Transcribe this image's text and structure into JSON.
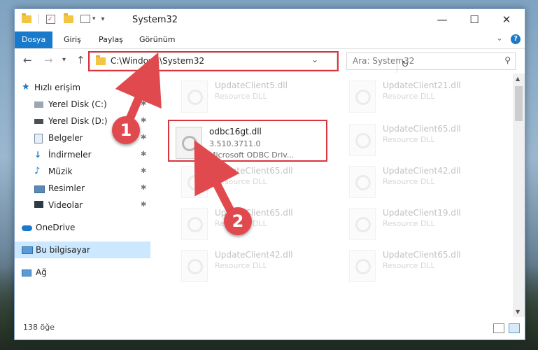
{
  "window": {
    "title": "System32",
    "dropdown_glyph": "▾",
    "controls": {
      "minimize": "—",
      "maximize": "☐",
      "close": "✕"
    }
  },
  "ribbon": {
    "tabs": [
      {
        "label": "Dosya",
        "active": true
      },
      {
        "label": "Giriş",
        "active": false
      },
      {
        "label": "Paylaş",
        "active": false
      },
      {
        "label": "Görünüm",
        "active": false
      }
    ],
    "collapse_glyph": "⌄",
    "help_glyph": "?"
  },
  "nav": {
    "back": "←",
    "forward": "→",
    "recent": "▾",
    "up": "↑",
    "address": "C:\\Windows\\System32",
    "address_dropdown": "⌄",
    "refresh": "↻",
    "search_placeholder": "Ara: System32",
    "search_icon": "⚲"
  },
  "sidebar": {
    "items": [
      {
        "label": "Hızlı erişim",
        "icon": "star-icon",
        "pinned": false
      },
      {
        "label": "Yerel Disk (C:)",
        "icon": "drive-icon",
        "pinned": true
      },
      {
        "label": "Yerel Disk (D:)",
        "icon": "drive-icon",
        "pinned": true
      },
      {
        "label": "Belgeler",
        "icon": "documents-icon",
        "pinned": true
      },
      {
        "label": "İndirmeler",
        "icon": "download-icon",
        "pinned": true
      },
      {
        "label": "Müzik",
        "icon": "music-icon",
        "pinned": true
      },
      {
        "label": "Resimler",
        "icon": "pictures-icon",
        "pinned": true
      },
      {
        "label": "Videolar",
        "icon": "videos-icon",
        "pinned": true
      },
      {
        "label": "OneDrive",
        "icon": "cloud-icon",
        "pinned": false
      },
      {
        "label": "Bu bilgisayar",
        "icon": "computer-icon",
        "pinned": false
      },
      {
        "label": "Ağ",
        "icon": "network-icon",
        "pinned": false
      }
    ],
    "pin_glyph": "📌"
  },
  "files": {
    "highlighted": {
      "name": "odbc16gt.dll",
      "version": "3.510.3711.0",
      "description": "Microsoft ODBC Driv..."
    },
    "left_column": [
      {
        "name": "UpdateClient5.dll",
        "type": "Resource DLL"
      },
      {
        "name": "UpdateClient65.dll",
        "type": "Resource DLL"
      },
      {
        "name": "UpdateClient65.dll",
        "type": "Resource DLL"
      },
      {
        "name": "UpdateClient42.dll",
        "type": "Resource DLL"
      }
    ],
    "right_column": [
      {
        "name": "UpdateClient21.dll",
        "type": "Resource DLL"
      },
      {
        "name": "UpdateClient65.dll",
        "type": "Resource DLL"
      },
      {
        "name": "UpdateClient42.dll",
        "type": "Resource DLL"
      },
      {
        "name": "UpdateClient19.dll",
        "type": "Resource DLL"
      },
      {
        "name": "UpdateClient65.dll",
        "type": "Resource DLL"
      }
    ]
  },
  "status": {
    "item_count": "138 öğe"
  },
  "annotations": {
    "badge1": "1",
    "badge2": "2",
    "accent": "#e04a4f"
  }
}
